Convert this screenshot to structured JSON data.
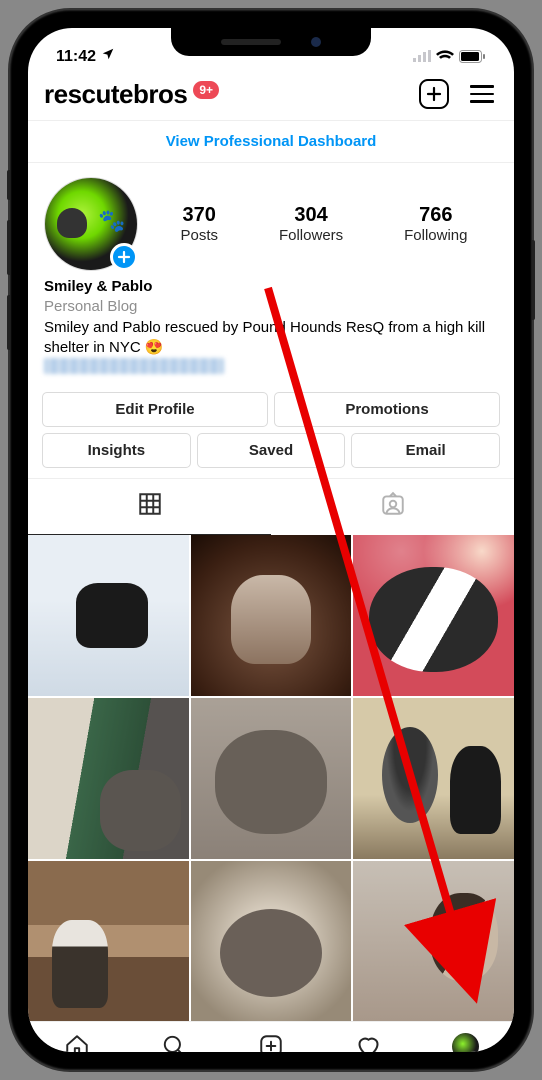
{
  "status": {
    "time": "11:42"
  },
  "header": {
    "username": "rescutebros",
    "notif_count": "9+"
  },
  "dashboard": {
    "link_label": "View Professional Dashboard"
  },
  "stats": {
    "posts": {
      "value": "370",
      "label": "Posts"
    },
    "followers": {
      "value": "304",
      "label": "Followers"
    },
    "following": {
      "value": "766",
      "label": "Following"
    }
  },
  "bio": {
    "display_name": "Smiley & Pablo",
    "category": "Personal Blog",
    "text": "Smiley and Pablo rescued by Pound Hounds ResQ from a high kill shelter in NYC 😍"
  },
  "buttons": {
    "edit_profile": "Edit Profile",
    "promotions": "Promotions",
    "insights": "Insights",
    "saved": "Saved",
    "email": "Email"
  },
  "icons": {
    "add": "add-icon",
    "menu": "menu-icon",
    "grid": "grid-icon",
    "tagged": "tagged-icon",
    "home": "home-icon",
    "search": "search-icon",
    "reels_add": "add-icon",
    "heart": "heart-icon",
    "profile": "profile-tab-icon"
  }
}
